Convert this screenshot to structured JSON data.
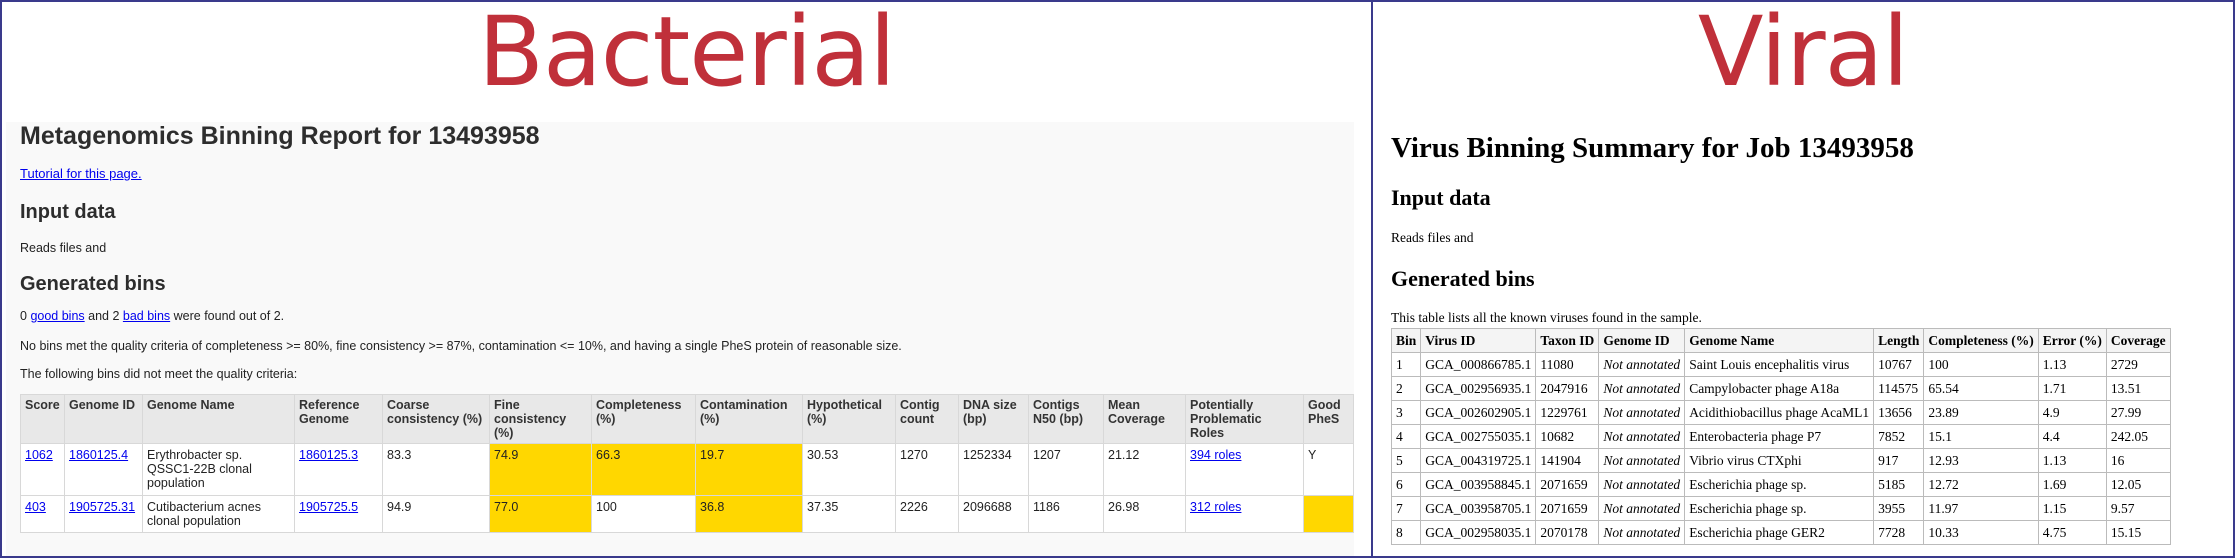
{
  "bacterial": {
    "banner": "Bacterial",
    "title": "Metagenomics Binning Report for 13493958",
    "tutorial_link": "Tutorial for this page.",
    "input_heading": "Input data",
    "input_text": "Reads files and",
    "generated_heading": "Generated bins",
    "count_text": {
      "prefix": "0 ",
      "good_link": "good bins",
      "middle": " and 2 ",
      "bad_link": "bad bins",
      "suffix": " were found out of 2."
    },
    "criteria_text": "No bins met the quality criteria of completeness >= 80%, fine consistency >= 87%, contamination <= 10%, and having a single PheS protein of reasonable size.",
    "following_text": "The following bins did not meet the quality criteria:",
    "columns": [
      "Score",
      "Genome ID",
      "Genome Name",
      "Reference Genome",
      "Coarse consistency (%)",
      "Fine consistency (%)",
      "Completeness (%)",
      "Contamination (%)",
      "Hypothetical (%)",
      "Contig count",
      "DNA size (bp)",
      "Contigs N50 (bp)",
      "Mean Coverage",
      "Potentially Problematic Roles",
      "Good PheS"
    ],
    "rows": [
      {
        "score": "1062",
        "genome_id": "1860125.4",
        "genome_name": "Erythrobacter sp. QSSC1-22B clonal population",
        "reference_genome": "1860125.3",
        "coarse": "83.3",
        "fine": "74.9",
        "completeness": "66.3",
        "contamination": "19.7",
        "hypothetical": "30.53",
        "contig_count": "1270",
        "dna_size": "1252334",
        "n50": "1207",
        "mean_coverage": "21.12",
        "problem_roles": "394 roles",
        "good_phes": "Y"
      },
      {
        "score": "403",
        "genome_id": "1905725.31",
        "genome_name": "Cutibacterium acnes clonal population",
        "reference_genome": "1905725.5",
        "coarse": "94.9",
        "fine": "77.0",
        "completeness": "100",
        "contamination": "36.8",
        "hypothetical": "37.35",
        "contig_count": "2226",
        "dna_size": "2096688",
        "n50": "1186",
        "mean_coverage": "26.98",
        "problem_roles": "312 roles",
        "good_phes": ""
      }
    ],
    "highlight_color": "#ffd700"
  },
  "viral": {
    "banner": "Viral",
    "title": "Virus Binning Summary for Job 13493958",
    "input_heading": "Input data",
    "input_text": "Reads files and",
    "generated_heading": "Generated bins",
    "description": "This table lists all the known viruses found in the sample.",
    "columns": [
      "Bin",
      "Virus ID",
      "Taxon ID",
      "Genome ID",
      "Genome Name",
      "Length",
      "Completeness (%)",
      "Error (%)",
      "Coverage"
    ],
    "rows": [
      [
        "1",
        "GCA_000866785.1",
        "11080",
        "Not annotated",
        "Saint Louis encephalitis virus",
        "10767",
        "100",
        "1.13",
        "2729"
      ],
      [
        "2",
        "GCA_002956935.1",
        "2047916",
        "Not annotated",
        "Campylobacter phage A18a",
        "114575",
        "65.54",
        "1.71",
        "13.51"
      ],
      [
        "3",
        "GCA_002602905.1",
        "1229761",
        "Not annotated",
        "Acidithiobacillus phage AcaML1",
        "13656",
        "23.89",
        "4.9",
        "27.99"
      ],
      [
        "4",
        "GCA_002755035.1",
        "10682",
        "Not annotated",
        "Enterobacteria phage P7",
        "7852",
        "15.1",
        "4.4",
        "242.05"
      ],
      [
        "5",
        "GCA_004319725.1",
        "141904",
        "Not annotated",
        "Vibrio virus CTXphi",
        "917",
        "12.93",
        "1.13",
        "16"
      ],
      [
        "6",
        "GCA_003958845.1",
        "2071659",
        "Not annotated",
        "Escherichia phage sp.",
        "5185",
        "12.72",
        "1.69",
        "12.05"
      ],
      [
        "7",
        "GCA_003958705.1",
        "2071659",
        "Not annotated",
        "Escherichia phage sp.",
        "3955",
        "11.97",
        "1.15",
        "9.57"
      ],
      [
        "8",
        "GCA_002958035.1",
        "2070178",
        "Not annotated",
        "Escherichia phage GER2",
        "7728",
        "10.33",
        "4.75",
        "15.15"
      ]
    ]
  },
  "colors": {
    "banner": "#c0303a",
    "panel_border": "#3a3a8c",
    "link": "#0000ee"
  }
}
